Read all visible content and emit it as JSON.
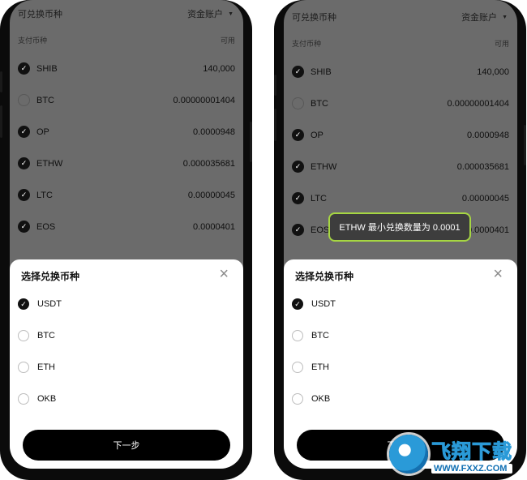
{
  "header": {
    "title": "可兑换币种",
    "account": "资金账户"
  },
  "columns": {
    "coin": "支付币种",
    "available": "可用"
  },
  "coins": [
    {
      "name": "SHIB",
      "amount": "140,000",
      "selected": true
    },
    {
      "name": "BTC",
      "amount": "0.00000001404",
      "selected": false
    },
    {
      "name": "OP",
      "amount": "0.0000948",
      "selected": true
    },
    {
      "name": "ETHW",
      "amount": "0.000035681",
      "selected": true
    },
    {
      "name": "LTC",
      "amount": "0.00000045",
      "selected": true
    },
    {
      "name": "EOS",
      "amount": "0.0000401",
      "selected": true
    }
  ],
  "sheet": {
    "title": "选择兑换币种",
    "options": [
      {
        "name": "USDT",
        "selected": true
      },
      {
        "name": "BTC",
        "selected": false
      },
      {
        "name": "ETH",
        "selected": false
      },
      {
        "name": "OKB",
        "selected": false
      }
    ],
    "next_label": "下一步"
  },
  "toast": {
    "text": "ETHW 最小兑换数量为 0.0001"
  },
  "watermark": {
    "brand": "飞翔下载",
    "url": "WWW.FXXZ.COM"
  },
  "colors": {
    "overlay": "#6b6b6b",
    "accent": "#000000",
    "toast_border": "#a6d642"
  }
}
